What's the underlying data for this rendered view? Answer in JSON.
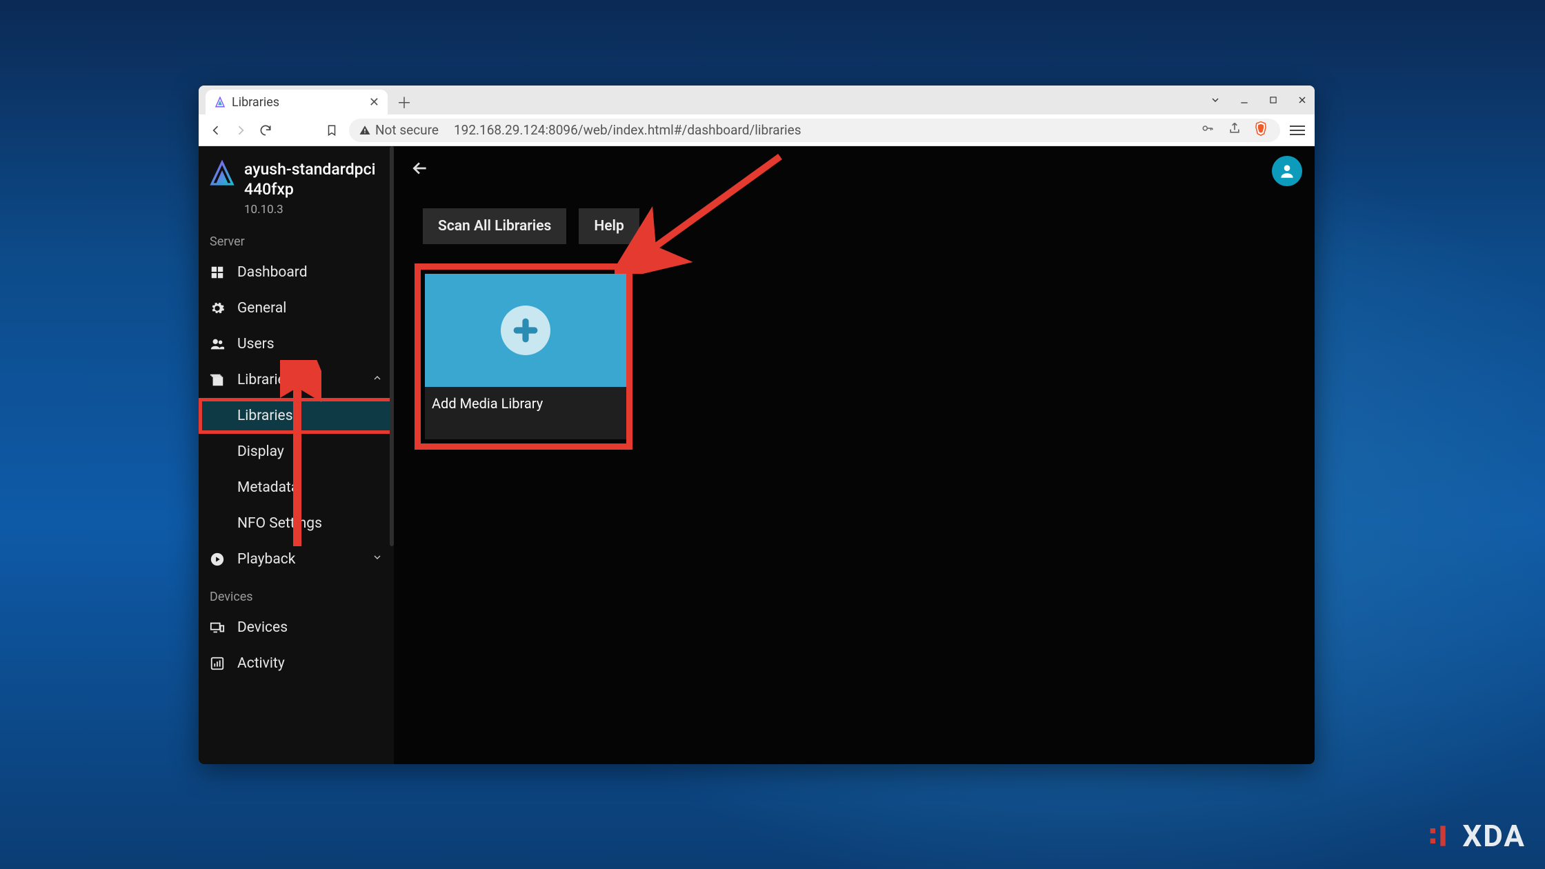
{
  "browser": {
    "tab_title": "Libraries",
    "url_security_label": "Not secure",
    "url": "192.168.29.124:8096/web/index.html#/dashboard/libraries"
  },
  "sidebar": {
    "server_name": "ayush-standardpci440fxp",
    "version": "10.10.3",
    "section_server": "Server",
    "section_devices": "Devices",
    "items": {
      "dashboard": "Dashboard",
      "general": "General",
      "users": "Users",
      "libraries": "Libraries",
      "playback": "Playback",
      "devices": "Devices",
      "activity": "Activity"
    },
    "lib_sub": {
      "libraries": "Libraries",
      "display": "Display",
      "metadata": "Metadata",
      "nfo": "NFO Settings"
    }
  },
  "content": {
    "scan_all": "Scan All Libraries",
    "help": "Help",
    "card_label": "Add Media Library"
  },
  "watermark": "XDA"
}
